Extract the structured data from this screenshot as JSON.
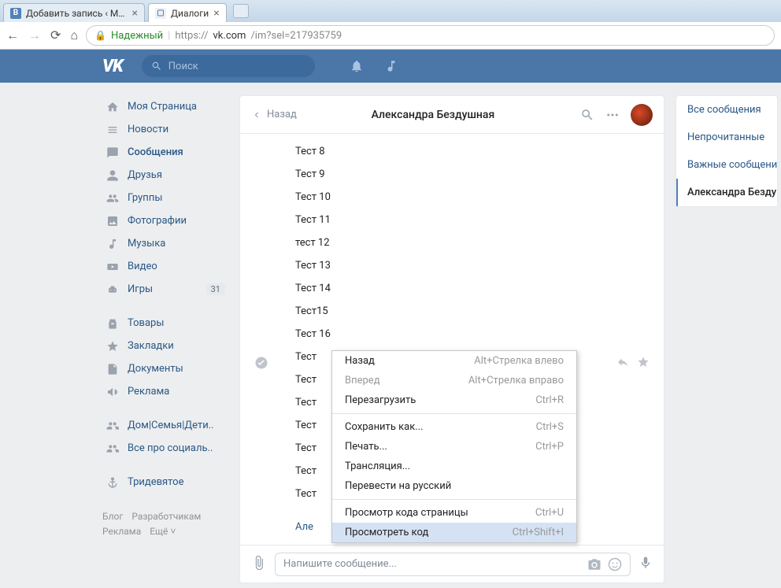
{
  "browser": {
    "tabs": [
      {
        "title": "Добавить запись ‹ Мир",
        "active": false,
        "favicon_bg": "#5181b8",
        "favicon_char": "В",
        "favicon_color": "#fff"
      },
      {
        "title": "Диалоги",
        "active": true,
        "favicon_bg": "#eef0f3",
        "favicon_char": "▢",
        "favicon_color": "#5181b8"
      }
    ],
    "secure_label": "Надежный",
    "url_prefix": "https://",
    "url_host": "vk.com",
    "url_path": "/im?sel=217935759"
  },
  "vk": {
    "logo": "VK",
    "search_placeholder": "Поиск"
  },
  "nav": {
    "items": [
      {
        "icon": "home",
        "label": "Моя Страница"
      },
      {
        "icon": "news",
        "label": "Новости"
      },
      {
        "icon": "msg",
        "label": "Сообщения",
        "active": true
      },
      {
        "icon": "friends",
        "label": "Друзья"
      },
      {
        "icon": "groups",
        "label": "Группы"
      },
      {
        "icon": "photo",
        "label": "Фотографии"
      },
      {
        "icon": "music",
        "label": "Музыка"
      },
      {
        "icon": "video",
        "label": "Видео"
      },
      {
        "icon": "games",
        "label": "Игры",
        "badge": "31"
      }
    ],
    "items2": [
      {
        "icon": "bag",
        "label": "Товары"
      },
      {
        "icon": "star",
        "label": "Закладки"
      },
      {
        "icon": "doc",
        "label": "Документы"
      },
      {
        "icon": "ads",
        "label": "Реклама"
      }
    ],
    "items3": [
      {
        "icon": "people",
        "label": "Дом|Семья|Дети.."
      },
      {
        "icon": "people",
        "label": "Все про социаль.."
      }
    ],
    "items4": [
      {
        "icon": "anchor",
        "label": "Тридевятое"
      }
    ],
    "footer": [
      "Блог",
      "Разработчикам",
      "Реклама",
      "Ещё ˅"
    ]
  },
  "dialog": {
    "back": "Назад",
    "peer": "Александра Бездушная",
    "messages": [
      "Тест 8",
      "Тест 9",
      "Тест 10",
      "Тест 11",
      "тест 12",
      "Тест 13",
      "Тест 14",
      "Тест15",
      "Тест 16",
      "Тест",
      "Тест",
      "Тест",
      "Тест",
      "Тест",
      "Тест",
      "Тест"
    ],
    "partial_author": "Але",
    "compose_placeholder": "Напишите сообщение..."
  },
  "right": {
    "items": [
      "Все сообщения",
      "Непрочитанные",
      "Важные сообщени"
    ],
    "selected": "Александра Безду"
  },
  "context_menu": {
    "items": [
      {
        "label": "Назад",
        "shortcut": "Alt+Стрелка влево"
      },
      {
        "label": "Вперед",
        "shortcut": "Alt+Стрелка вправо",
        "disabled": true
      },
      {
        "label": "Перезагрузить",
        "shortcut": "Ctrl+R"
      },
      {
        "sep": true
      },
      {
        "label": "Сохранить как...",
        "shortcut": "Ctrl+S"
      },
      {
        "label": "Печать...",
        "shortcut": "Ctrl+P"
      },
      {
        "label": "Трансляция..."
      },
      {
        "label": "Перевести на русский"
      },
      {
        "sep": true
      },
      {
        "label": "Просмотр кода страницы",
        "shortcut": "Ctrl+U"
      },
      {
        "label": "Просмотреть код",
        "shortcut": "Ctrl+Shift+I",
        "highlighted": true
      }
    ]
  }
}
